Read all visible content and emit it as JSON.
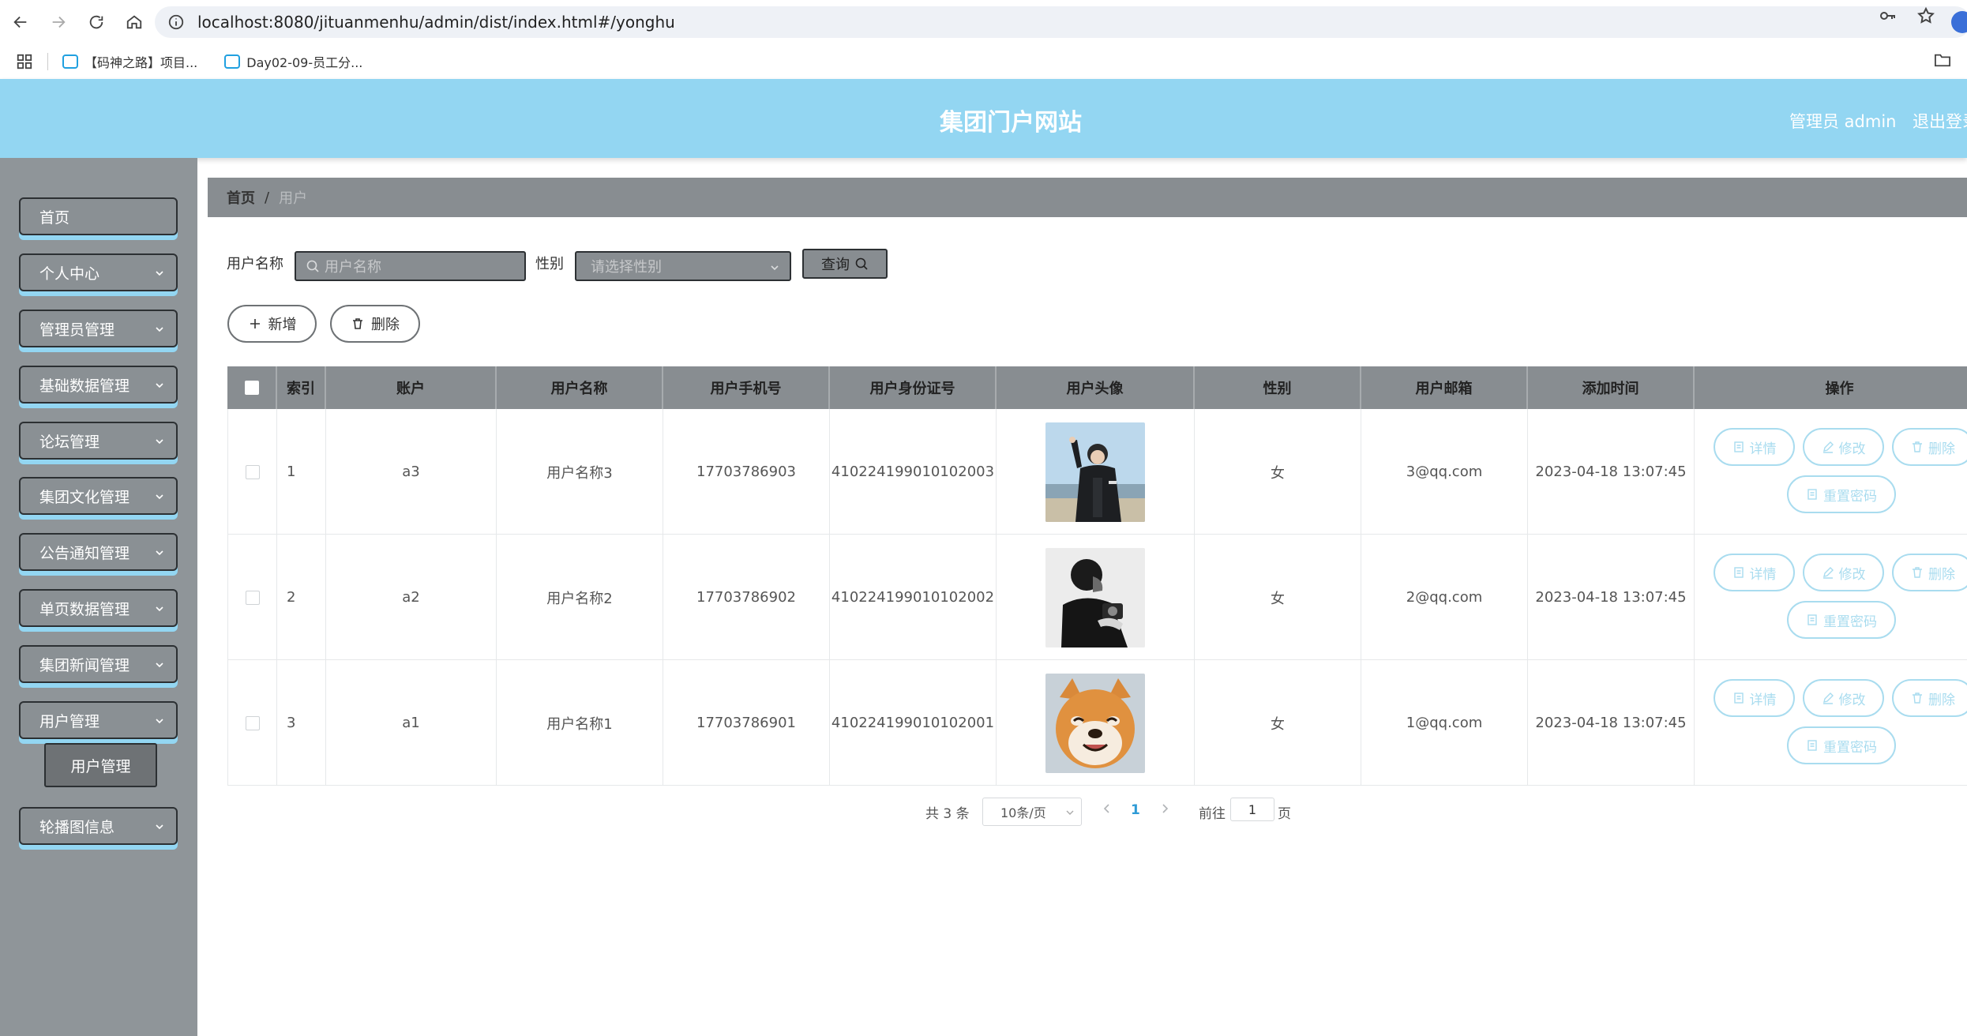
{
  "browser": {
    "url": "localhost:8080/jituanmenhu/admin/dist/index.html#/yonghu",
    "bookmarks": [
      "【码神之路】项目...",
      "Day02-09-员工分..."
    ]
  },
  "header": {
    "title": "集团门户网站",
    "user": "管理员 admin",
    "logout": "退出登录"
  },
  "sidebar": {
    "items": [
      "首页",
      "个人中心",
      "管理员管理",
      "基础数据管理",
      "论坛管理",
      "集团文化管理",
      "公告通知管理",
      "单页数据管理",
      "集团新闻管理",
      "用户管理",
      "轮播图信息"
    ],
    "submenu_label": "用户管理"
  },
  "breadcrumb": {
    "home": "首页",
    "separator": "/",
    "current": "用户"
  },
  "search": {
    "name_label": "用户名称",
    "name_placeholder": "用户名称",
    "gender_label": "性别",
    "gender_placeholder": "请选择性别",
    "query_label": "查询"
  },
  "actions": {
    "add_label": "新增",
    "delete_label": "删除"
  },
  "table": {
    "headers": [
      "",
      "索引",
      "账户",
      "用户名称",
      "用户手机号",
      "用户身份证号",
      "用户头像",
      "性别",
      "用户邮箱",
      "添加时间",
      "操作"
    ],
    "rows": [
      {
        "index": "1",
        "account": "a3",
        "name": "用户名称3",
        "phone": "17703786903",
        "id_card": "410224199010102003",
        "avatar": "young-man-avatar",
        "gender": "女",
        "email": "3@qq.com",
        "time": "2023-04-18 13:07:45"
      },
      {
        "index": "2",
        "account": "a2",
        "name": "用户名称2",
        "phone": "17703786902",
        "id_card": "410224199010102002",
        "avatar": "monochrome-man-avatar",
        "gender": "女",
        "email": "2@qq.com",
        "time": "2023-04-18 13:07:45"
      },
      {
        "index": "3",
        "account": "a1",
        "name": "用户名称1",
        "phone": "17703786901",
        "id_card": "410224199010102001",
        "avatar": "shiba-dog-avatar",
        "gender": "女",
        "email": "1@qq.com",
        "time": "2023-04-18 13:07:45"
      }
    ],
    "ops": {
      "detail": "详情",
      "edit": "修改",
      "delete": "删除",
      "reset": "重置密码"
    }
  },
  "pagination": {
    "total": "共 3 条",
    "page_size": "10条/页",
    "current": "1",
    "goto_label": "前往",
    "goto_value": "1",
    "page_suffix": "页"
  },
  "colors": {
    "header_bg": "#93d6f2",
    "sidebar_bg": "#8f9599",
    "accent": "#a9dcef",
    "active_page": "#2e9bd6"
  }
}
